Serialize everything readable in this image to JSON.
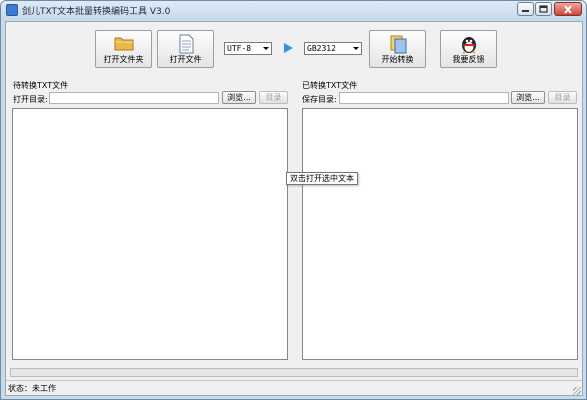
{
  "window": {
    "title": "剑儿TXT文本批量转换编码工具 V3.0"
  },
  "toolbar": {
    "open_folder_label": "打开文件夹",
    "open_file_label": "打开文件",
    "source_encoding": "UTF-8",
    "target_encoding": "GB2312",
    "start_convert_label": "开始转换",
    "feedback_label": "我要反馈"
  },
  "left_panel": {
    "title": "待转换TXT文件",
    "dir_label": "打开目录:",
    "path_value": "",
    "browse_label": "浏览...",
    "dir_button_label": "目录"
  },
  "right_panel": {
    "title": "已转换TXT文件",
    "dir_label": "保存目录:",
    "path_value": "",
    "browse_label": "浏览...",
    "dir_button_label": "目录"
  },
  "tooltip": "双击打开选中文本",
  "progress": {
    "value_percent": 0
  },
  "status": "状态：未工作",
  "colors": {
    "accent": "#3a8fde",
    "window_frame": "#c9daea",
    "client_bg": "#f0f0f0"
  },
  "icons": [
    "folder-icon",
    "document-icon",
    "play-arrow-icon",
    "convert-icon",
    "qq-penguin-icon"
  ]
}
